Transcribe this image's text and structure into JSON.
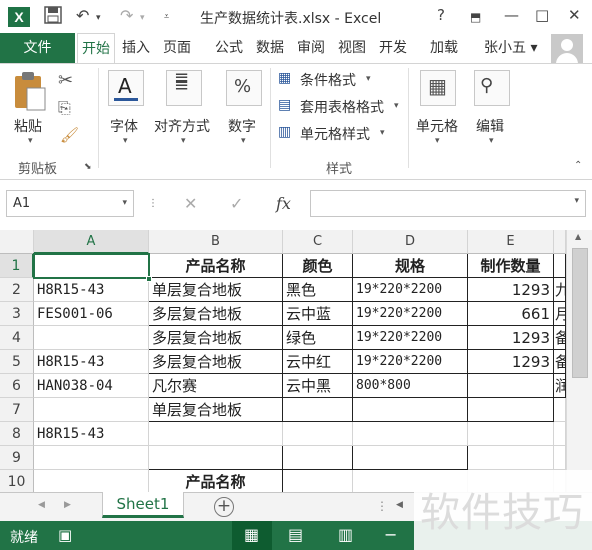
{
  "titlebar": {
    "logo": "X",
    "title": "生产数据统计表.xlsx - Excel",
    "help": "?",
    "minimize": "—",
    "maximize": "□",
    "close": "✕"
  },
  "ribbon_tabs": {
    "file": "文件",
    "tabs": [
      "开始",
      "插入",
      "页面",
      "公式",
      "数据",
      "审阅",
      "视图",
      "开发",
      "加载"
    ],
    "active": "开始",
    "user": "张小五 ▾"
  },
  "ribbon": {
    "paste": "粘贴",
    "clipboard_group": "剪贴板",
    "font": "字体",
    "alignment": "对齐方式",
    "number": "数字",
    "conditional_format": "条件格式",
    "table_format": "套用表格格式",
    "cell_style": "单元格样式",
    "styles_group": "样式",
    "cells": "单元格",
    "editing": "编辑"
  },
  "formula_bar": {
    "namebox": "A1",
    "fx": "fx",
    "value": ""
  },
  "grid": {
    "columns": [
      "A",
      "B",
      "C",
      "D",
      "E"
    ],
    "rows": [
      "1",
      "2",
      "3",
      "4",
      "5",
      "6",
      "7",
      "8",
      "9",
      "10"
    ],
    "cells": {
      "B1": "产品名称",
      "C1": "颜色",
      "D1": "规格",
      "E1": "制作数量",
      "A2": "H8R15-43",
      "B2": "单层复合地板",
      "C2": "黑色",
      "D2": "19*220*2200",
      "E2": "1293",
      "F2": "九",
      "A3": "FES001-06",
      "B3": "多层复合地板",
      "C3": "云中蓝",
      "D3": "19*220*2200",
      "E3": "661",
      "F3": "月",
      "B4": "多层复合地板",
      "C4": "绿色",
      "D4": "19*220*2200",
      "E4": "1293",
      "F4": "备",
      "A5": "H8R15-43",
      "B5": "多层复合地板",
      "C5": "云中红",
      "D5": "19*220*2200",
      "E5": "1293",
      "F5": "备",
      "A6": "HAN038-04",
      "B6": "凡尔赛",
      "C6": "云中黑",
      "D6": "800*800",
      "F6": "润",
      "B7": "单层复合地板",
      "A8": "H8R15-43",
      "B10": "产品名称"
    }
  },
  "sheets": {
    "active": "Sheet1",
    "add": "+"
  },
  "status": {
    "ready": "就绪"
  },
  "watermark": "软件技巧"
}
